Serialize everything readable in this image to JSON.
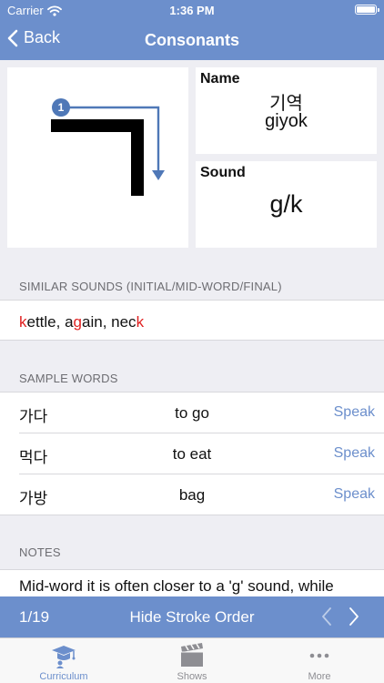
{
  "status_bar": {
    "carrier": "Carrier",
    "time": "1:36 PM"
  },
  "nav": {
    "back_label": "Back",
    "title": "Consonants"
  },
  "letter": {
    "glyph": "ㄱ",
    "stroke_number": "1"
  },
  "name": {
    "label": "Name",
    "korean": "기역",
    "romanized": "giyok"
  },
  "sound": {
    "label": "Sound",
    "value": "g/k"
  },
  "similar_sounds": {
    "header": "SIMILAR SOUNDS (INITIAL/MID-WORD/FINAL)",
    "segments": [
      {
        "text": "k",
        "highlight": true
      },
      {
        "text": "ettle, a",
        "highlight": false
      },
      {
        "text": "g",
        "highlight": true
      },
      {
        "text": "ain, nec",
        "highlight": false
      },
      {
        "text": "k",
        "highlight": true
      }
    ]
  },
  "sample_words": {
    "header": "SAMPLE WORDS",
    "speak_label": "Speak",
    "items": [
      {
        "korean": "가다",
        "meaning": "to go"
      },
      {
        "korean": "먹다",
        "meaning": "to eat"
      },
      {
        "korean": "가방",
        "meaning": "bag"
      }
    ]
  },
  "notes": {
    "header": "NOTES",
    "text": "Mid-word it is often closer to a 'g' sound, while"
  },
  "stroke_toolbar": {
    "page": "1/19",
    "toggle_label": "Hide Stroke Order"
  },
  "tabs": [
    {
      "label": "Curriculum",
      "icon": "graduation-cap-icon",
      "active": true
    },
    {
      "label": "Shows",
      "icon": "clapperboard-icon",
      "active": false
    },
    {
      "label": "More",
      "icon": "more-dots-icon",
      "active": false
    }
  ],
  "colors": {
    "accent": "#6c8fcc",
    "highlight": "#e02020",
    "background": "#eeeef3"
  }
}
